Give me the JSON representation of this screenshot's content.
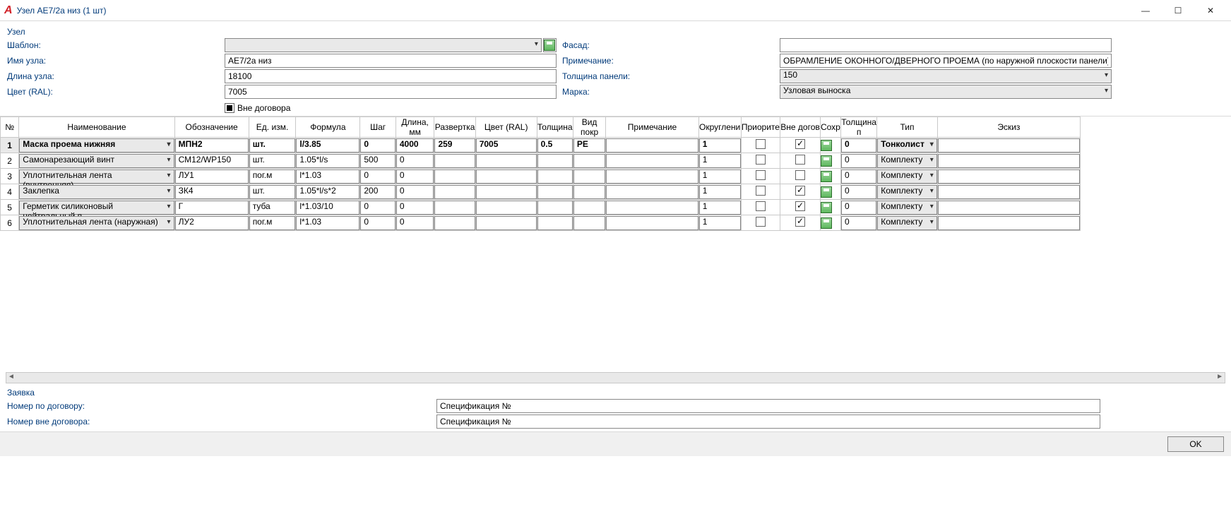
{
  "window": {
    "title": "Узел АЕ7/2а низ (1 шт)"
  },
  "section": {
    "uzel": "Узел",
    "zayavka": "Заявка"
  },
  "form": {
    "labels": {
      "shablon": "Шаблон:",
      "fasad": "Фасад:",
      "imya": "Имя узла:",
      "prim": "Примечание:",
      "dlina": "Длина узла:",
      "tolsch": "Толщина панели:",
      "cvet": "Цвет (RAL):",
      "marka": "Марка:",
      "vne": "Вне договора"
    },
    "vals": {
      "shablon": "",
      "fasad": "",
      "imya": "АЕ7/2а низ",
      "prim": "ОБРАМЛЕНИЕ ОКОННОГО/ДВЕРНОГО ПРОЕМА (по наружной плоскости панели)",
      "dlina": "18100",
      "tolsch": "150",
      "cvet": "7005",
      "marka": "Узловая выноска"
    }
  },
  "cols": {
    "no": "№",
    "name": "Наименование",
    "obozn": "Обозначение",
    "ed": "Ед. изм.",
    "formula": "Формула",
    "shag": "Шаг",
    "dlina": "Длина, мм",
    "razv": "Развертка",
    "cvet": "Цвет (RAL)",
    "tolsch": "Толщина",
    "vid": "Вид покр",
    "prim": "Примечание",
    "okr": "Округлени",
    "prio": "Приорите",
    "vne": "Вне догов",
    "sohr": "Сохр",
    "tolp": "Толщина п",
    "tip": "Тип",
    "eskiz": "Эскиз"
  },
  "rows": [
    {
      "no": "1",
      "name": "Маска проема нижняя",
      "obozn": "МПН2",
      "ed": "шт.",
      "formula": "l/3.85",
      "shag": "0",
      "dlina": "4000",
      "razv": "259",
      "cvet": "7005",
      "tolsch": "0.5",
      "vid": "PE",
      "prim": "",
      "okr": "1",
      "prio": false,
      "vne": true,
      "tolp": "0",
      "tip": "Тонколист",
      "eskiz": "",
      "active": true
    },
    {
      "no": "2",
      "name": "Самонарезающий винт",
      "obozn": "СМ12/WP150",
      "ed": "шт.",
      "formula": "1.05*l/s",
      "shag": "500",
      "dlina": "0",
      "razv": "",
      "cvet": "",
      "tolsch": "",
      "vid": "",
      "prim": "",
      "okr": "1",
      "prio": false,
      "vne": false,
      "tolp": "0",
      "tip": "Комплекту",
      "eskiz": ""
    },
    {
      "no": "3",
      "name": "Уплотнительная лента (внутренняя)",
      "obozn": "ЛУ1",
      "ed": "пог.м",
      "formula": "l*1.03",
      "shag": "0",
      "dlina": "0",
      "razv": "",
      "cvet": "",
      "tolsch": "",
      "vid": "",
      "prim": "",
      "okr": "1",
      "prio": false,
      "vne": false,
      "tolp": "0",
      "tip": "Комплекту",
      "eskiz": ""
    },
    {
      "no": "4",
      "name": "Заклепка",
      "obozn": "ЗК4",
      "ed": "шт.",
      "formula": "1.05*l/s*2",
      "shag": "200",
      "dlina": "0",
      "razv": "",
      "cvet": "",
      "tolsch": "",
      "vid": "",
      "prim": "",
      "okr": "1",
      "prio": false,
      "vne": true,
      "tolp": "0",
      "tip": "Комплекту",
      "eskiz": ""
    },
    {
      "no": "5",
      "name": "Герметик силиконовый нейтральный п",
      "obozn": "Г",
      "ed": "туба",
      "formula": "l*1.03/10",
      "shag": "0",
      "dlina": "0",
      "razv": "",
      "cvet": "",
      "tolsch": "",
      "vid": "",
      "prim": "",
      "okr": "1",
      "prio": false,
      "vne": true,
      "tolp": "0",
      "tip": "Комплекту",
      "eskiz": ""
    },
    {
      "no": "6",
      "name": "Уплотнительная лента (наружная)",
      "obozn": "ЛУ2",
      "ed": "пог.м",
      "formula": "l*1.03",
      "shag": "0",
      "dlina": "0",
      "razv": "",
      "cvet": "",
      "tolsch": "",
      "vid": "",
      "prim": "",
      "okr": "1",
      "prio": false,
      "vne": true,
      "tolp": "0",
      "tip": "Комплекту",
      "eskiz": ""
    }
  ],
  "bottom": {
    "labels": {
      "nd": "Номер по договору:",
      "nvd": "Номер вне договора:"
    },
    "vals": {
      "nd": "",
      "nvd": "",
      "spec1": "Спецификация №",
      "spec2": "Спецификация №"
    }
  },
  "footer": {
    "ok": "OK"
  }
}
